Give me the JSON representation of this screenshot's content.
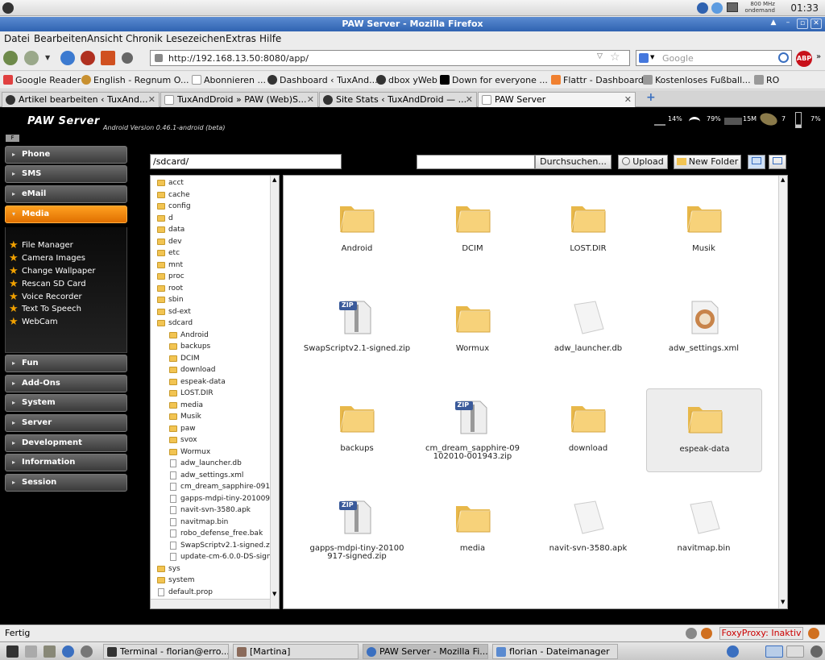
{
  "system": {
    "clock": "01:33",
    "cpu_line1": "800 MHz",
    "cpu_line2": "ondemand"
  },
  "window": {
    "title": "PAW Server - Mozilla Firefox"
  },
  "menu": [
    "Datei",
    "Bearbeiten",
    "Ansicht",
    "Chronik",
    "Lesezeichen",
    "Extras",
    "Hilfe"
  ],
  "nav": {
    "url": "http://192.168.13.50:8080/app/",
    "search_placeholder": "Google",
    "abp": "ABP"
  },
  "bookmarks": [
    "Google Reader",
    "English - Regnum O...",
    "Abonnieren ...",
    "Dashboard ‹ TuxAnd...",
    "dbox yWeb",
    "Down for everyone ...",
    "Flattr - Dashboard",
    "Kostenloses Fußball...",
    "RO"
  ],
  "tabs": [
    {
      "label": "Artikel bearbeiten ‹ TuxAnd..."
    },
    {
      "label": "TuxAndDroid » PAW (Web)S..."
    },
    {
      "label": "Site Stats ‹ TuxAndDroid — ..."
    },
    {
      "label": "PAW Server"
    }
  ],
  "app": {
    "logo": "PAW Server",
    "version": "Android Version 0.46.1-android (beta)",
    "f_icon": "F",
    "status": {
      "battery_left": "14%",
      "wifi": "79%",
      "memory": "15M",
      "sat": "7",
      "battery": "7%"
    }
  },
  "sidebar": {
    "sections": [
      "Phone",
      "SMS",
      "eMail",
      "Media",
      "Fun",
      "Add-Ons",
      "System",
      "Server",
      "Development",
      "Information",
      "Session"
    ],
    "media_items": [
      "File Manager",
      "Camera Images",
      "Change Wallpaper",
      "Rescan SD Card",
      "Voice Recorder",
      "Text To Speech",
      "WebCam"
    ]
  },
  "filemanager": {
    "path": "/sdcard/",
    "browse_label": "Durchsuchen...",
    "upload_label": "Upload",
    "new_folder_label": "New Folder",
    "tree_root": [
      "acct",
      "cache",
      "config",
      "d",
      "data",
      "dev",
      "etc",
      "mnt",
      "proc",
      "root",
      "sbin",
      "sd-ext",
      "sdcard"
    ],
    "tree_sdcard_folders": [
      "Android",
      "backups",
      "DCIM",
      "download",
      "espeak-data",
      "LOST.DIR",
      "media",
      "Musik",
      "paw",
      "svox",
      "Wormux"
    ],
    "tree_sdcard_files": [
      "adw_launcher.db",
      "adw_settings.xml",
      "cm_dream_sapphire-091",
      "gapps-mdpi-tiny-201009",
      "navit-svn-3580.apk",
      "navitmap.bin",
      "robo_defense_free.bak",
      "SwapScriptv2.1-signed.z",
      "update-cm-6.0.0-DS-sign"
    ],
    "tree_tail": [
      "sys",
      "system",
      "default.prop"
    ],
    "grid": [
      {
        "name": "Android",
        "kind": "folder"
      },
      {
        "name": "DCIM",
        "kind": "folder"
      },
      {
        "name": "LOST.DIR",
        "kind": "folder"
      },
      {
        "name": "Musik",
        "kind": "folder"
      },
      {
        "name": "SwapScriptv2.1-signed.zip",
        "kind": "zip"
      },
      {
        "name": "Wormux",
        "kind": "folder"
      },
      {
        "name": "adw_launcher.db",
        "kind": "file"
      },
      {
        "name": "adw_settings.xml",
        "kind": "xml"
      },
      {
        "name": "backups",
        "kind": "folder"
      },
      {
        "name": "cm_dream_sapphire-09102010-001943.zip",
        "kind": "zip"
      },
      {
        "name": "download",
        "kind": "folder"
      },
      {
        "name": "espeak-data",
        "kind": "folder",
        "selected": true
      },
      {
        "name": "gapps-mdpi-tiny-20100917-signed.zip",
        "kind": "zip"
      },
      {
        "name": "media",
        "kind": "folder"
      },
      {
        "name": "navit-svn-3580.apk",
        "kind": "file"
      },
      {
        "name": "navitmap.bin",
        "kind": "file"
      }
    ],
    "zip_badge": "ZIP"
  },
  "statusbar": {
    "text": "Fertig",
    "foxyproxy": "FoxyProxy: Inaktiv"
  },
  "taskbar": [
    {
      "label": "Terminal - florian@erro..."
    },
    {
      "label": "[Martina]"
    },
    {
      "label": "PAW Server - Mozilla Fi..."
    },
    {
      "label": "florian - Dateimanager"
    }
  ]
}
